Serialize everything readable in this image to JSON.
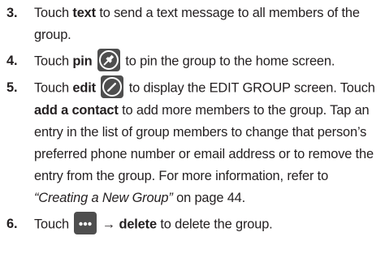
{
  "steps": [
    {
      "number": "3.",
      "t1": "Touch ",
      "b1": "text",
      "t2": " to send a text message to all members of the group."
    },
    {
      "number": "4.",
      "t1": "Touch ",
      "b1": "pin",
      "icon": "pin-icon",
      "t2": " to pin the group to the home screen."
    },
    {
      "number": "5.",
      "t1": "Touch ",
      "b1": "edit",
      "icon": "edit-icon",
      "t2": " to display the EDIT GROUP screen. Touch ",
      "b2": "add a contact",
      "t3": " to add more members to the group. Tap an entry in the list of group members to change that person’s preferred phone number or email address or to remove the entry from the group. For more information, refer to ",
      "i1": "“Creating a New Group”",
      "t4": " on page 44."
    },
    {
      "number": "6.",
      "t1": "Touch ",
      "icon": "more-icon",
      "arrow": "→",
      "b1": "delete",
      "t2": " to delete the group."
    }
  ],
  "colors": {
    "text": "#231f20",
    "icon_background": "#4e4e4e",
    "icon_glyph": "#ffffff"
  }
}
